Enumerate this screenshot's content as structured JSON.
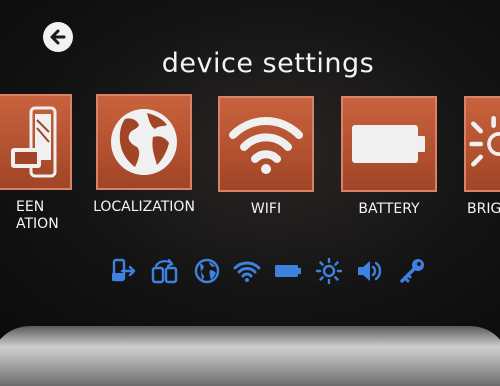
{
  "header": {
    "title": "device settings",
    "back_icon": "arrow-left-icon"
  },
  "tiles": [
    {
      "label": "EEN\nATION",
      "icon": "tablet-screen-icon"
    },
    {
      "label": "LOCALIZATION",
      "icon": "globe-icon"
    },
    {
      "label": "WIFI",
      "icon": "wifi-icon"
    },
    {
      "label": "BATTERY",
      "icon": "battery-icon"
    },
    {
      "label": "BRIG",
      "icon": "brightness-icon"
    }
  ],
  "quick_icons": [
    "screen-rotation-icon",
    "device-orientation-icon",
    "globe-icon",
    "wifi-icon",
    "battery-icon",
    "brightness-icon",
    "volume-icon",
    "key-icon"
  ],
  "colors": {
    "tile": "#b5522f",
    "tile_border": "#d9826a",
    "quick_icon": "#3e82e0",
    "text": "#f3f3f3"
  }
}
